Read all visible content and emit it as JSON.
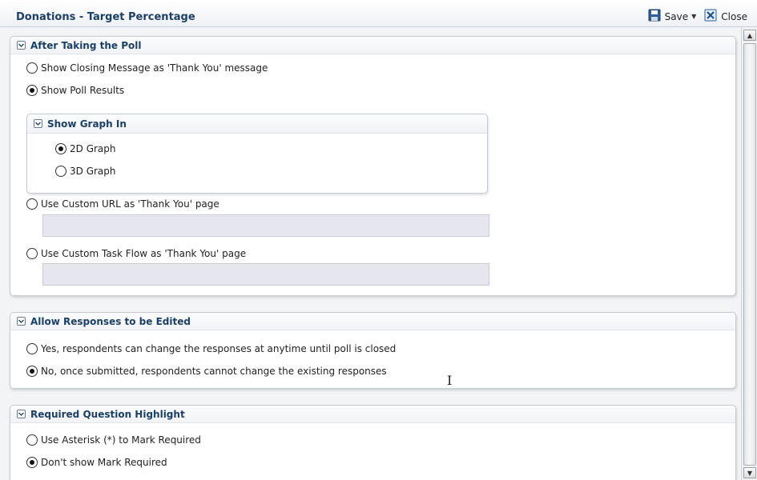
{
  "window": {
    "title": "Donations - Target Percentage"
  },
  "toolbar": {
    "save_label": "Save",
    "close_label": "Close"
  },
  "sections": {
    "after_poll": {
      "title": "After Taking the Poll",
      "options": [
        {
          "label": "Show Closing Message as 'Thank You' message",
          "selected": false
        },
        {
          "label": "Show Poll Results",
          "selected": true
        },
        {
          "label": "Use Custom URL as 'Thank You' page",
          "selected": false
        },
        {
          "label": "Use Custom Task Flow as 'Thank You' page",
          "selected": false
        }
      ],
      "custom_url_value": "",
      "custom_task_flow_value": "",
      "graph": {
        "title": "Show Graph In",
        "options": [
          {
            "label": "2D Graph",
            "selected": true
          },
          {
            "label": "3D Graph",
            "selected": false
          }
        ]
      }
    },
    "allow_edit": {
      "title": "Allow Responses to be Edited",
      "options": [
        {
          "label": "Yes, respondents can change the responses at anytime until poll is closed",
          "selected": false
        },
        {
          "label": "No, once submitted, respondents cannot change the existing responses",
          "selected": true
        }
      ]
    },
    "required_highlight": {
      "title": "Required Question Highlight",
      "options": [
        {
          "label": "Use Asterisk (*) to Mark Required",
          "selected": false
        },
        {
          "label": "Don't show Mark Required",
          "selected": true
        }
      ]
    }
  },
  "icons": {
    "save": "floppy-disk-icon",
    "close": "close-x-icon",
    "collapse": "chevron-down-icon"
  },
  "colors": {
    "accent": "#1c3f66",
    "field_bg": "#e6e7ee"
  }
}
